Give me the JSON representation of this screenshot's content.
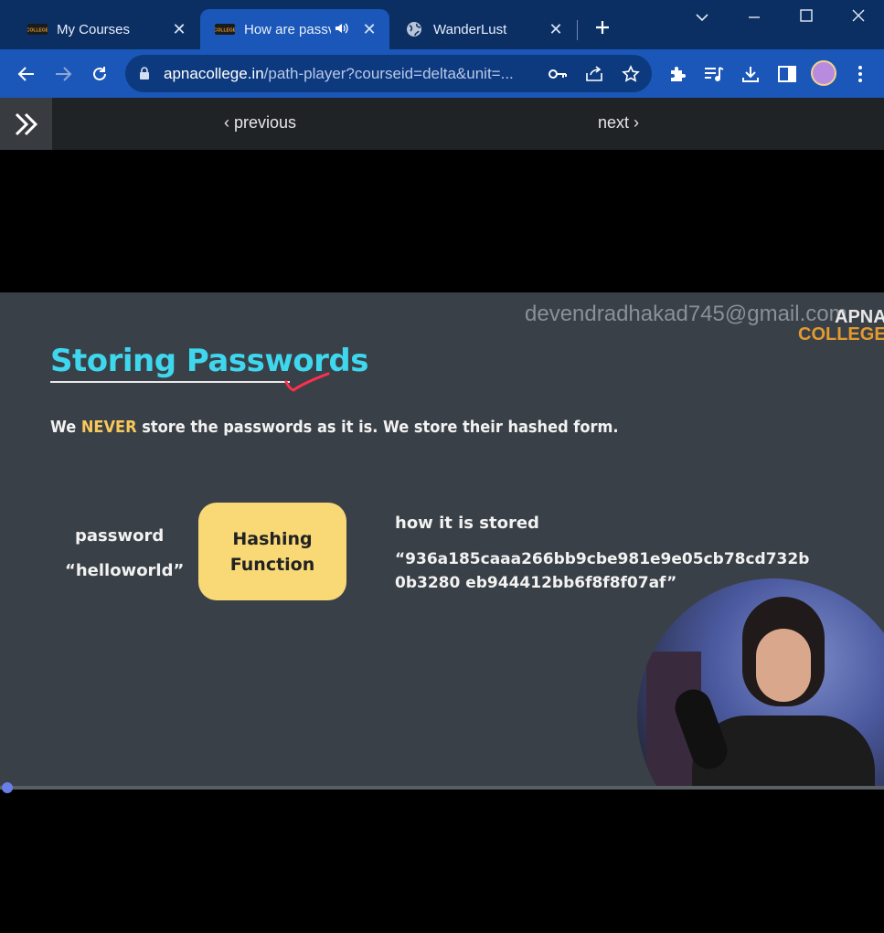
{
  "tabs": [
    {
      "label": "My Courses",
      "active": false
    },
    {
      "label": "How are passv",
      "active": true,
      "audio": true
    },
    {
      "label": "WanderLust",
      "active": false
    }
  ],
  "address": {
    "domain": "apnacollege.in",
    "path": "/path-player?courseid=delta&unit=..."
  },
  "nav": {
    "previous": "previous",
    "next": "next"
  },
  "slide": {
    "watermark": "devendradhakad745@gmail.com",
    "logo_line1": "APNA",
    "logo_line2": "COLLEGE",
    "title": "Storing Passwords",
    "subtitle_pre": "We ",
    "subtitle_em": "NEVER",
    "subtitle_post": " store the passwords as it is. We store their hashed form.",
    "input_label": "password",
    "input_value": "“helloworld”",
    "box_line1": "Hashing",
    "box_line2": "Function",
    "stored_label": "how it is stored",
    "hash_value": "“936a185caaa266bb9cbe981e9e05cb78cd732b0b3280 eb944412bb6f8f8f07af”"
  },
  "colors": {
    "titlebar": "#0b2f63",
    "toolbar": "#1a57b8",
    "slide_bg": "#394047",
    "title": "#3fd7ee",
    "accent": "#f8c95a",
    "box": "#f9d876"
  }
}
